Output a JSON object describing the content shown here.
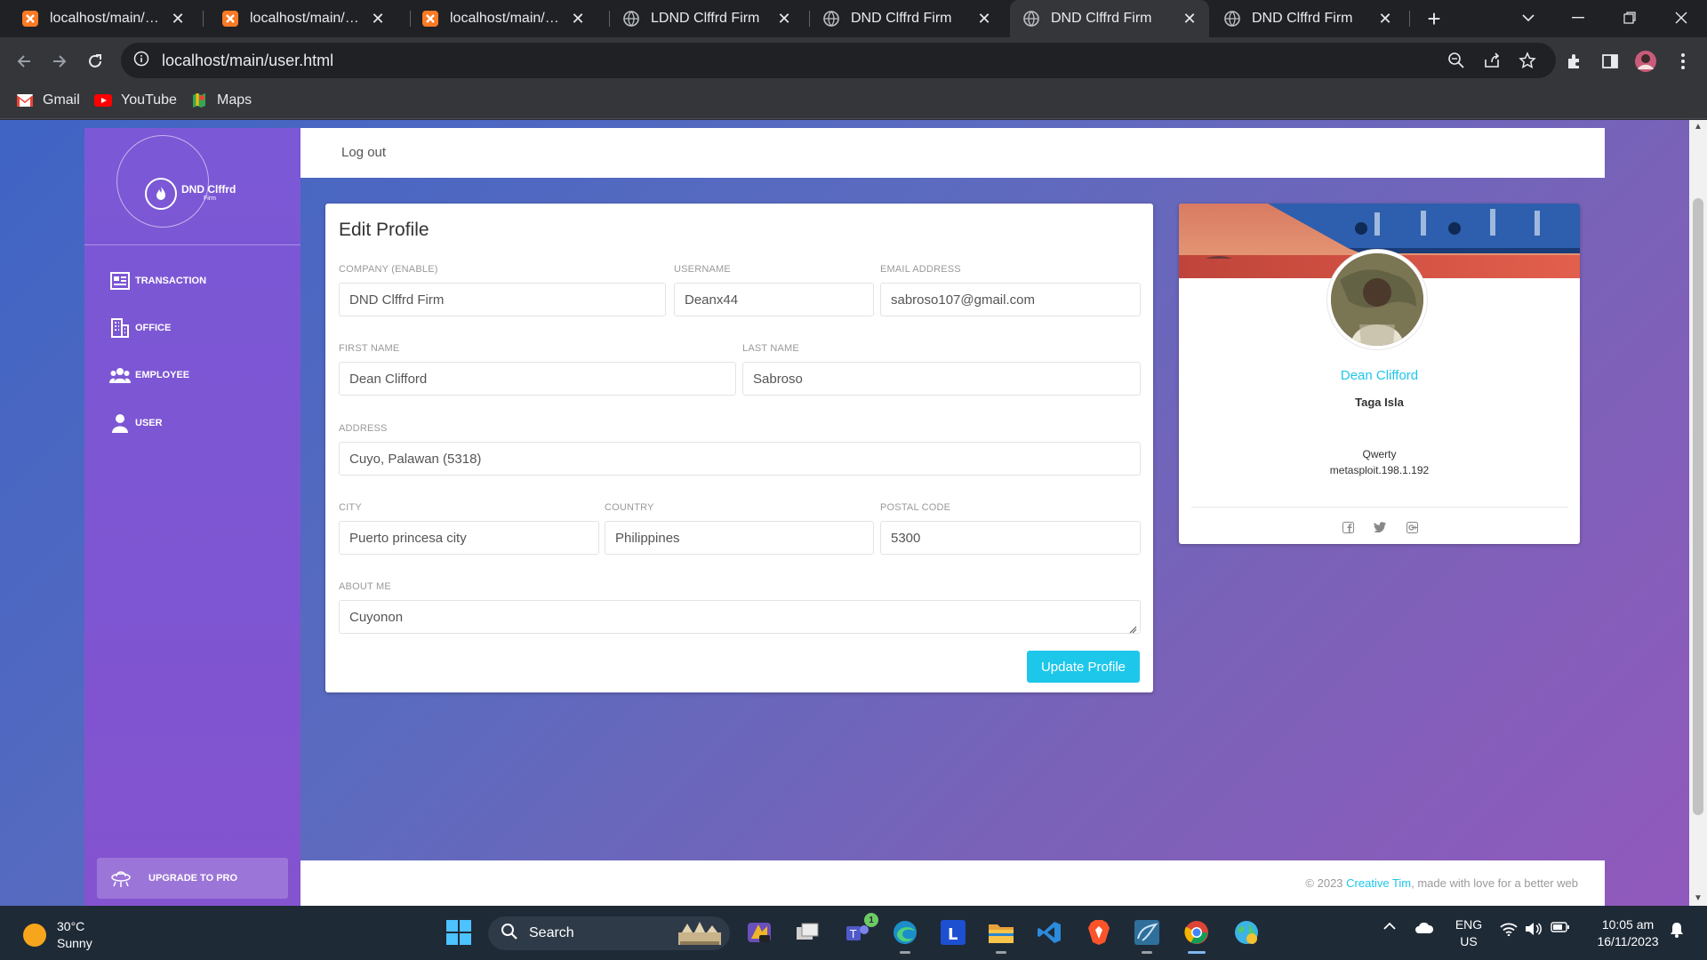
{
  "browser": {
    "tabs": [
      {
        "title": "localhost/main/add_",
        "favicon": "xampp-icon"
      },
      {
        "title": "localhost/main/add_",
        "favicon": "xampp-icon"
      },
      {
        "title": "localhost/main/add_",
        "favicon": "xampp-icon"
      },
      {
        "title": "LDND Clffrd Firm",
        "favicon": "globe-icon"
      },
      {
        "title": "DND Clffrd Firm",
        "favicon": "globe-icon"
      },
      {
        "title": "DND Clffrd Firm",
        "favicon": "globe-icon",
        "active": true
      },
      {
        "title": "DND Clffrd Firm",
        "favicon": "globe-icon"
      }
    ],
    "url_host": "localhost",
    "url_path": "/main/user.html",
    "bookmarks": [
      {
        "label": "Gmail",
        "icon": "gmail-icon"
      },
      {
        "label": "YouTube",
        "icon": "youtube-icon"
      },
      {
        "label": "Maps",
        "icon": "maps-icon"
      }
    ]
  },
  "sidebar": {
    "logo_title": "DND Clffrd",
    "logo_sub": "Firm",
    "items": [
      {
        "label": "TRANSACTION",
        "icon": "transaction-icon"
      },
      {
        "label": "OFFICE",
        "icon": "building-icon"
      },
      {
        "label": "EMPLOYEE",
        "icon": "group-icon"
      },
      {
        "label": "USER",
        "icon": "user-icon"
      }
    ],
    "upgrade_label": "UPGRADE TO PRO"
  },
  "topbar": {
    "logout_label": "Log out"
  },
  "edit_profile": {
    "title": "Edit Profile",
    "company": {
      "label": "COMPANY (ENABLE)",
      "value": "DND Clffrd Firm"
    },
    "username": {
      "label": "USERNAME",
      "value": "Deanx44"
    },
    "email": {
      "label": "EMAIL ADDRESS",
      "value": "sabroso107@gmail.com"
    },
    "first_name": {
      "label": "FIRST NAME",
      "value": "Dean Clifford"
    },
    "last_name": {
      "label": "LAST NAME",
      "value": "Sabroso"
    },
    "address": {
      "label": "ADDRESS",
      "value": "Cuyo, Palawan (5318)"
    },
    "city": {
      "label": "CITY",
      "value": "Puerto princesa city"
    },
    "country": {
      "label": "COUNTRY",
      "value": "Philippines"
    },
    "postal": {
      "label": "POSTAL CODE",
      "value": "5300"
    },
    "about": {
      "label": "ABOUT ME",
      "value": "Cuyonon"
    },
    "submit_label": "Update Profile"
  },
  "profile_card": {
    "name": "Dean Clifford",
    "role": "Taga Isla",
    "line1": "Qwerty",
    "line2": "metasploit.198.1.192",
    "social": [
      "facebook-icon",
      "twitter-icon",
      "google-plus-icon"
    ]
  },
  "footer": {
    "prefix": "© 2023 ",
    "link": "Creative Tim",
    "suffix": ", made with love for a better web"
  },
  "taskbar": {
    "temp": "30°C",
    "condition": "Sunny",
    "search_label": "Search",
    "lang_top": "ENG",
    "lang_bottom": "US",
    "time": "10:05 am",
    "date": "16/11/2023",
    "teams_badge": "1"
  },
  "colors": {
    "accent": "#1dc7ea",
    "sidebar": "#7b58d6",
    "background_start": "#3f64c4",
    "background_end": "#9159bd"
  }
}
